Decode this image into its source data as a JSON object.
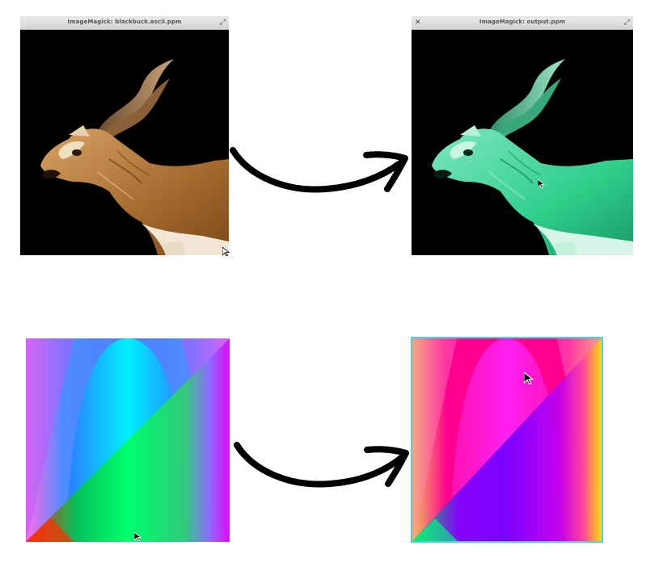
{
  "windows": {
    "input_title": "ImageMagick: blackbuck.ascii.ppm",
    "output_title": "ImageMagick: output.ppm"
  },
  "icons": {
    "close": "close-icon",
    "maximize": "maximize-icon",
    "arrow": "curved-arrow-icon",
    "cursor": "mouse-pointer-icon"
  },
  "colors": {
    "input_tone": "#b97a3c",
    "output_tone": "#3fd69a",
    "output_border": "#4cd3e0"
  }
}
